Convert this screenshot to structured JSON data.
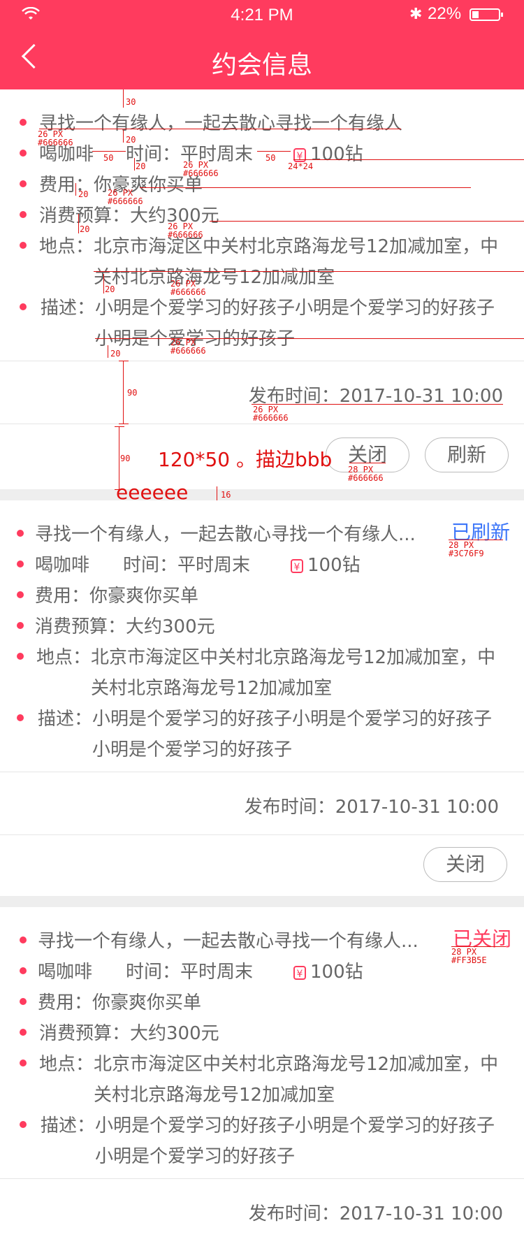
{
  "status_bar": {
    "time": "4:21 PM",
    "battery_pct": "22%",
    "battery_level": 0.22
  },
  "nav": {
    "title": "约会信息"
  },
  "cards": [
    {
      "title": "寻找一个有缘人，一起去散心寻找一个有缘人",
      "activity": "喝咖啡",
      "time": "时间：平时周末",
      "diamonds": "100钻",
      "fee": "费用：你豪爽你买单",
      "budget": "消费预算：大约300元",
      "location_1": "地点：北京市海淀区中关村北京路海龙号12加减加室，中",
      "location_2": "关村北京路海龙号12加减加室",
      "desc_1": "描述：小明是个爱学习的好孩子小明是个爱学习的好孩子",
      "desc_2": "小明是个爱学习的好孩子",
      "publish": "发布时间：2017-10-31  10:00",
      "buttons": [
        "关闭",
        "刷新"
      ]
    },
    {
      "title": "寻找一个有缘人，一起去散心寻找一个有缘人...",
      "status": "已刷新",
      "activity": "喝咖啡",
      "time": "时间：平时周末",
      "diamonds": "100钻",
      "fee": "费用：你豪爽你买单",
      "budget": "消费预算：大约300元",
      "location_1": "地点：北京市海淀区中关村北京路海龙号12加减加室，中",
      "location_2": "关村北京路海龙号12加减加室",
      "desc_1": "描述：小明是个爱学习的好孩子小明是个爱学习的好孩子",
      "desc_2": "小明是个爱学习的好孩子",
      "publish": "发布时间：2017-10-31  10:00",
      "buttons": [
        "关闭"
      ]
    },
    {
      "title": "寻找一个有缘人，一起去散心寻找一个有缘人...",
      "status": "已关闭",
      "activity": "喝咖啡",
      "time": "时间：平时周末",
      "diamonds": "100钻",
      "fee": "费用：你豪爽你买单",
      "budget": "消费预算：大约300元",
      "location_1": "地点：北京市海淀区中关村北京路海龙号12加减加室，中",
      "location_2": "关村北京路海龙号12加减加室",
      "desc_1": "描述：小明是个爱学习的好孩子小明是个爱学习的好孩子",
      "desc_2": "小明是个爱学习的好孩子",
      "publish": "发布时间：2017-10-31  10:00"
    }
  ],
  "annotations": {
    "px26": "26 PX",
    "px28": "28 PX",
    "c666": "#666666",
    "c3c76f9": "#3C76F9",
    "cff3b5e": "#FF3B5E",
    "n30": "30",
    "n20": "20",
    "n50": "50",
    "n90": "90",
    "n16": "16",
    "icon_size": "24*24",
    "button_spec": "120*50 。描边bbb",
    "gap_color": "eeeeee"
  },
  "colors": {
    "brand": "#FF3B5E",
    "refreshed": "#3C76F9",
    "closed": "#FF3B5E",
    "text": "#666666",
    "gap": "#eeeeee",
    "border": "#bbbbbb"
  }
}
